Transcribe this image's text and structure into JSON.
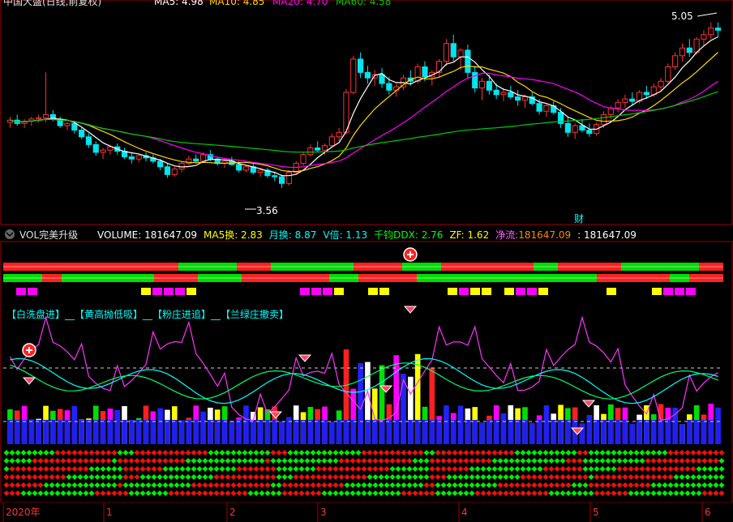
{
  "top_panel": {
    "title": "中国大盛(日线,前复权)",
    "ma5_label": "MA5: 4.98",
    "ma10_label": "MA10: 4.85",
    "ma20_label": "MA20: 4.70",
    "ma60_label": "MA60: 4.58",
    "high_price_label": "5.05",
    "low_price_label": "3.56",
    "event_marker": "财",
    "colors": {
      "up": "#ff3232",
      "down": "#00e5ee",
      "ma5": "#ffffff",
      "ma10": "#ffd700",
      "ma20": "#ff00ff",
      "ma60": "#00cc00",
      "frame": "#c00000"
    }
  },
  "indicator_panel": {
    "name": "VOL完美升级",
    "fields": [
      {
        "text": "VOLUME: 181647.09",
        "color": "#ffffff"
      },
      {
        "text": "MA5换: 2.83",
        "color": "#ffff00"
      },
      {
        "text": "月换: 8.87",
        "color": "#00ffff"
      },
      {
        "text": "V倍: 1.13",
        "color": "#00ffff"
      },
      {
        "text": "千钧DDX: 2.76",
        "color": "#00ff00"
      },
      {
        "text": "ZF: 1.62",
        "color": "#ffff00"
      },
      {
        "text": "净流: ",
        "color": "#ff66ff"
      },
      {
        "text": "181647.09",
        "color": "#ff8800"
      },
      {
        "text": ": 181647.09",
        "color": "#ffffff"
      }
    ],
    "legend": "【白洗盘进】__【黄高抛低吸】__【粉庄进追】__【兰绿庄撤卖】"
  },
  "x_axis": {
    "labels": [
      {
        "text": "2020年",
        "color": "#ff3333"
      },
      {
        "text": "1",
        "color": "#ff3333"
      },
      {
        "text": "2",
        "color": "#ff3333"
      },
      {
        "text": "3",
        "color": "#ff3333"
      },
      {
        "text": "4",
        "color": "#ff3333"
      },
      {
        "text": "5",
        "color": "#ff3333"
      },
      {
        "text": "6",
        "color": "#ff3333"
      }
    ]
  },
  "chart_data": {
    "type": "candlestick",
    "title": "中国大盛(日线,前复权)",
    "x_labels": [
      "2020年",
      "1",
      "2",
      "3",
      "4",
      "5",
      "6"
    ],
    "ohlc": [
      [
        4.15,
        4.2,
        4.1,
        4.17
      ],
      [
        4.17,
        4.22,
        4.12,
        4.14
      ],
      [
        4.14,
        4.18,
        4.1,
        4.16
      ],
      [
        4.16,
        4.2,
        4.12,
        4.18
      ],
      [
        4.18,
        4.22,
        4.15,
        4.19
      ],
      [
        4.19,
        4.6,
        4.15,
        4.22
      ],
      [
        4.22,
        4.26,
        4.16,
        4.18
      ],
      [
        4.18,
        4.2,
        4.1,
        4.12
      ],
      [
        4.12,
        4.15,
        4.08,
        4.14
      ],
      [
        4.14,
        4.16,
        4.05,
        4.08
      ],
      [
        4.08,
        4.1,
        4.0,
        4.02
      ],
      [
        4.02,
        4.05,
        3.92,
        3.95
      ],
      [
        3.95,
        3.98,
        3.85,
        3.88
      ],
      [
        3.88,
        3.92,
        3.82,
        3.9
      ],
      [
        3.9,
        3.95,
        3.86,
        3.93
      ],
      [
        3.93,
        3.96,
        3.86,
        3.89
      ],
      [
        3.89,
        3.92,
        3.82,
        3.84
      ],
      [
        3.84,
        3.88,
        3.78,
        3.82
      ],
      [
        3.82,
        3.86,
        3.79,
        3.85
      ],
      [
        3.85,
        3.88,
        3.8,
        3.83
      ],
      [
        3.83,
        3.86,
        3.78,
        3.8
      ],
      [
        3.8,
        3.82,
        3.72,
        3.75
      ],
      [
        3.75,
        3.78,
        3.65,
        3.68
      ],
      [
        3.68,
        3.75,
        3.66,
        3.73
      ],
      [
        3.73,
        3.8,
        3.7,
        3.78
      ],
      [
        3.78,
        3.85,
        3.76,
        3.82
      ],
      [
        3.82,
        3.86,
        3.78,
        3.8
      ],
      [
        3.8,
        3.88,
        3.79,
        3.86
      ],
      [
        3.86,
        3.9,
        3.8,
        3.82
      ],
      [
        3.82,
        3.84,
        3.76,
        3.78
      ],
      [
        3.78,
        3.82,
        3.74,
        3.8
      ],
      [
        3.8,
        3.84,
        3.76,
        3.77
      ],
      [
        3.77,
        3.8,
        3.7,
        3.72
      ],
      [
        3.72,
        3.76,
        3.7,
        3.75
      ],
      [
        3.75,
        3.78,
        3.68,
        3.7
      ],
      [
        3.7,
        3.74,
        3.66,
        3.72
      ],
      [
        3.72,
        3.74,
        3.65,
        3.67
      ],
      [
        3.67,
        3.7,
        3.62,
        3.66
      ],
      [
        3.66,
        3.68,
        3.56,
        3.6
      ],
      [
        3.6,
        3.72,
        3.58,
        3.7
      ],
      [
        3.7,
        3.8,
        3.68,
        3.78
      ],
      [
        3.78,
        3.88,
        3.76,
        3.86
      ],
      [
        3.86,
        3.95,
        3.84,
        3.92
      ],
      [
        3.92,
        3.98,
        3.88,
        3.9
      ],
      [
        3.9,
        3.96,
        3.86,
        3.94
      ],
      [
        3.94,
        4.05,
        3.92,
        4.02
      ],
      [
        4.02,
        4.1,
        3.98,
        4.06
      ],
      [
        4.06,
        4.45,
        4.04,
        4.42
      ],
      [
        4.42,
        4.75,
        4.4,
        4.72
      ],
      [
        4.72,
        4.78,
        4.55,
        4.6
      ],
      [
        4.6,
        4.66,
        4.5,
        4.55
      ],
      [
        4.55,
        4.62,
        4.48,
        4.58
      ],
      [
        4.58,
        4.64,
        4.46,
        4.5
      ],
      [
        4.5,
        4.56,
        4.4,
        4.44
      ],
      [
        4.44,
        4.5,
        4.38,
        4.47
      ],
      [
        4.47,
        4.58,
        4.44,
        4.55
      ],
      [
        4.55,
        4.62,
        4.48,
        4.52
      ],
      [
        4.52,
        4.68,
        4.5,
        4.65
      ],
      [
        4.65,
        4.7,
        4.52,
        4.56
      ],
      [
        4.56,
        4.62,
        4.48,
        4.6
      ],
      [
        4.6,
        4.72,
        4.56,
        4.7
      ],
      [
        4.7,
        4.9,
        4.66,
        4.86
      ],
      [
        4.86,
        4.94,
        4.7,
        4.74
      ],
      [
        4.74,
        4.82,
        4.62,
        4.8
      ],
      [
        4.8,
        4.85,
        4.55,
        4.6
      ],
      [
        4.6,
        4.66,
        4.42,
        4.46
      ],
      [
        4.46,
        4.55,
        4.35,
        4.52
      ],
      [
        4.52,
        4.58,
        4.4,
        4.44
      ],
      [
        4.44,
        4.5,
        4.36,
        4.4
      ],
      [
        4.4,
        4.46,
        4.34,
        4.42
      ],
      [
        4.42,
        4.48,
        4.36,
        4.38
      ],
      [
        4.38,
        4.44,
        4.3,
        4.35
      ],
      [
        4.35,
        4.4,
        4.28,
        4.38
      ],
      [
        4.38,
        4.42,
        4.3,
        4.32
      ],
      [
        4.32,
        4.36,
        4.22,
        4.25
      ],
      [
        4.25,
        4.32,
        4.2,
        4.3
      ],
      [
        4.3,
        4.34,
        4.22,
        4.24
      ],
      [
        4.24,
        4.28,
        4.1,
        4.14
      ],
      [
        4.14,
        4.2,
        4.02,
        4.06
      ],
      [
        4.06,
        4.14,
        4.0,
        4.12
      ],
      [
        4.12,
        4.18,
        4.06,
        4.08
      ],
      [
        4.08,
        4.14,
        4.02,
        4.05
      ],
      [
        4.05,
        4.15,
        4.03,
        4.13
      ],
      [
        4.13,
        4.25,
        4.1,
        4.22
      ],
      [
        4.22,
        4.3,
        4.18,
        4.28
      ],
      [
        4.28,
        4.36,
        4.24,
        4.33
      ],
      [
        4.33,
        4.4,
        4.28,
        4.36
      ],
      [
        4.36,
        4.42,
        4.3,
        4.34
      ],
      [
        4.34,
        4.44,
        4.32,
        4.42
      ],
      [
        4.42,
        4.48,
        4.36,
        4.4
      ],
      [
        4.4,
        4.5,
        4.38,
        4.47
      ],
      [
        4.47,
        4.55,
        4.44,
        4.52
      ],
      [
        4.52,
        4.68,
        4.5,
        4.65
      ],
      [
        4.65,
        4.78,
        4.62,
        4.75
      ],
      [
        4.75,
        4.86,
        4.7,
        4.82
      ],
      [
        4.82,
        4.9,
        4.74,
        4.78
      ],
      [
        4.78,
        4.92,
        4.76,
        4.9
      ],
      [
        4.9,
        4.98,
        4.84,
        4.94
      ],
      [
        4.94,
        5.05,
        4.9,
        5.0
      ],
      [
        5.0,
        5.05,
        4.92,
        4.98
      ]
    ],
    "ma5": 4.98,
    "ma10": 4.85,
    "ma20": 4.7,
    "ma60": 4.58,
    "ylim": [
      3.5,
      5.15
    ],
    "annotations": [
      "5.05",
      "3.56",
      "财"
    ]
  }
}
